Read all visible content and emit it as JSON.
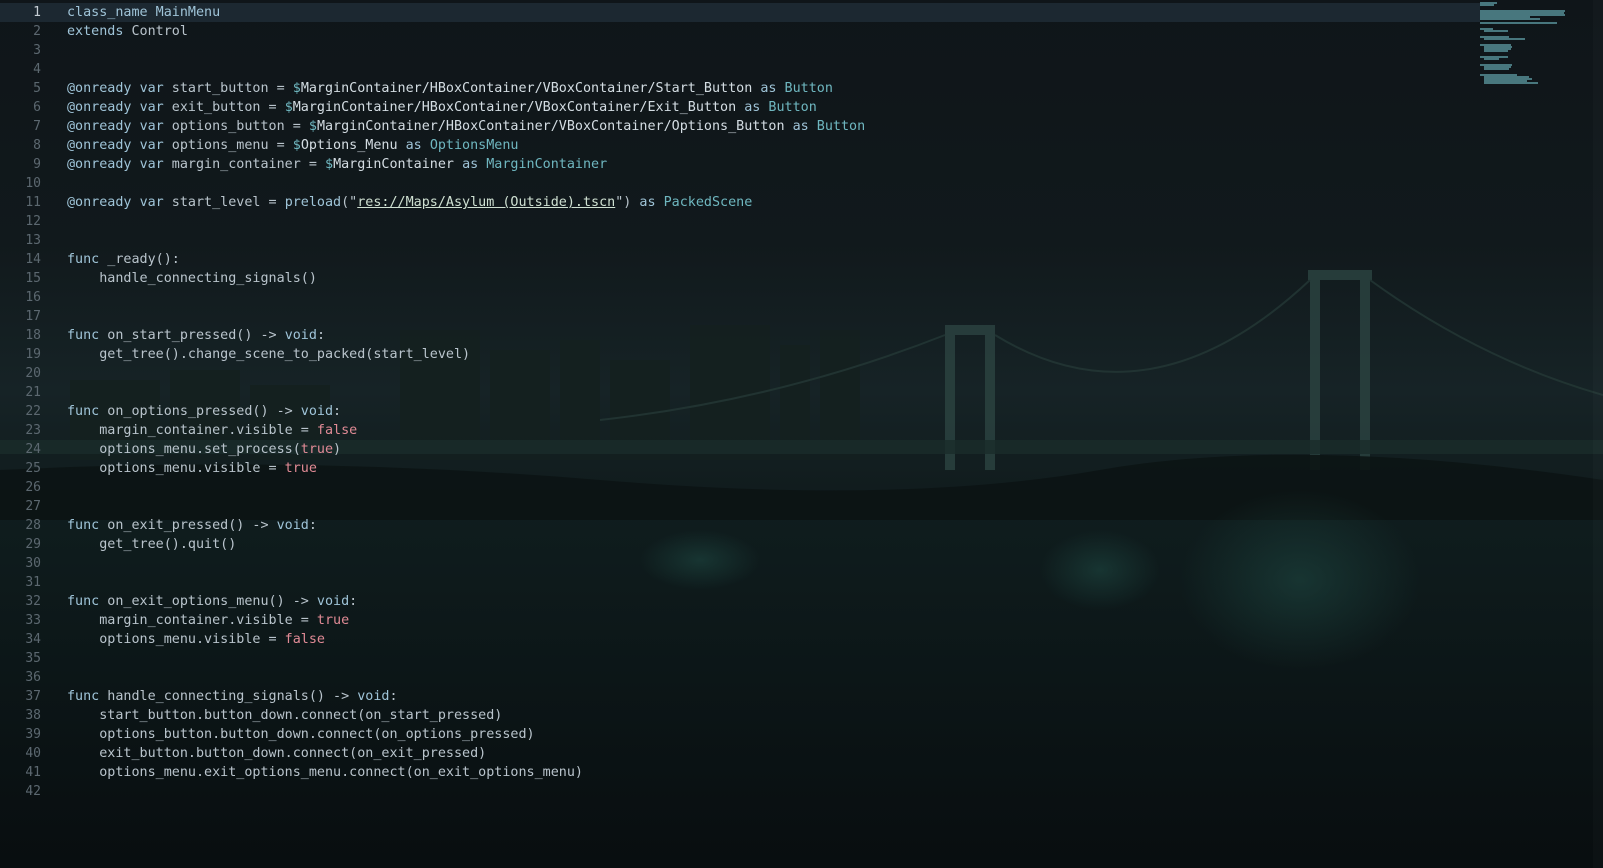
{
  "editor": {
    "language": "GDScript",
    "current_line": 1
  },
  "lines": [
    "class_name MainMenu",
    "extends Control",
    "",
    "",
    "@onready var start_button = $MarginContainer/HBoxContainer/VBoxContainer/Start_Button as Button",
    "@onready var exit_button = $MarginContainer/HBoxContainer/VBoxContainer/Exit_Button as Button",
    "@onready var options_button = $MarginContainer/HBoxContainer/VBoxContainer/Options_Button as Button",
    "@onready var options_menu = $Options_Menu as OptionsMenu",
    "@onready var margin_container = $MarginContainer as MarginContainer",
    "",
    "@onready var start_level = preload(\"res://Maps/Asylum (Outside).tscn\") as PackedScene",
    "",
    "",
    "func _ready():",
    "    handle_connecting_signals()",
    "",
    "",
    "func on_start_pressed() -> void:",
    "    get_tree().change_scene_to_packed(start_level)",
    "",
    "",
    "func on_options_pressed() -> void:",
    "    margin_container.visible = false",
    "    options_menu.set_process(true)",
    "    options_menu.visible = true",
    "",
    "",
    "func on_exit_pressed() -> void:",
    "    get_tree().quit()",
    "",
    "",
    "func on_exit_options_menu() -> void:",
    "    margin_container.visible = true",
    "    options_menu.visible = false",
    "",
    "",
    "func handle_connecting_signals() -> void:",
    "    start_button.button_down.connect(on_start_pressed)",
    "    options_button.button_down.connect(on_options_pressed)",
    "    exit_button.button_down.connect(on_exit_pressed)",
    "    options_menu.exit_options_menu.connect(on_exit_options_menu)",
    ""
  ],
  "colors": {
    "background": "#0d1216",
    "keyword": "#9fc4d8",
    "identifier": "#7fd0d6",
    "function": "#a9e7e6",
    "boolean": "#e08a95",
    "line_number": "#5c6870"
  }
}
